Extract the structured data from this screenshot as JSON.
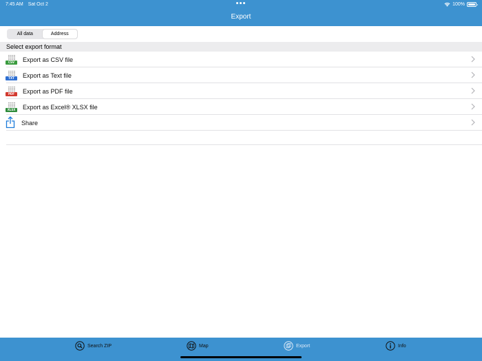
{
  "status_bar": {
    "time": "7:45 AM",
    "date": "Sat Oct 2",
    "battery": "100%"
  },
  "header": {
    "title": "Export"
  },
  "segmented": [
    {
      "label": "All data",
      "selected": false
    },
    {
      "label": "Address",
      "selected": true
    }
  ],
  "section": {
    "title": "Select export format"
  },
  "rows": [
    {
      "label": "Export as CSV file",
      "icon": "csv-file-icon",
      "tag": "CSV",
      "tag_color": "#3a9b3f"
    },
    {
      "label": "Export as Text file",
      "icon": "txt-file-icon",
      "tag": "TXT",
      "tag_color": "#2f6fd1"
    },
    {
      "label": "Export as PDF file",
      "icon": "pdf-file-icon",
      "tag": "PDF",
      "tag_color": "#d23a2f"
    },
    {
      "label": "Export as Excel® XLSX file",
      "icon": "xlsx-file-icon",
      "tag": "XLSX",
      "tag_color": "#2e8b3a"
    },
    {
      "label": "Share",
      "icon": "share-icon"
    }
  ],
  "tabs": [
    {
      "label": "Search ZIP",
      "icon": "search-icon",
      "active": false
    },
    {
      "label": "Map",
      "icon": "map-icon",
      "active": false
    },
    {
      "label": "Export",
      "icon": "export-icon",
      "active": true
    },
    {
      "label": "Info",
      "icon": "info-icon",
      "active": false
    }
  ],
  "colors": {
    "accent": "#3d92d0",
    "share_icon": "#1a7ad9",
    "chevron": "#b3b3b8"
  }
}
